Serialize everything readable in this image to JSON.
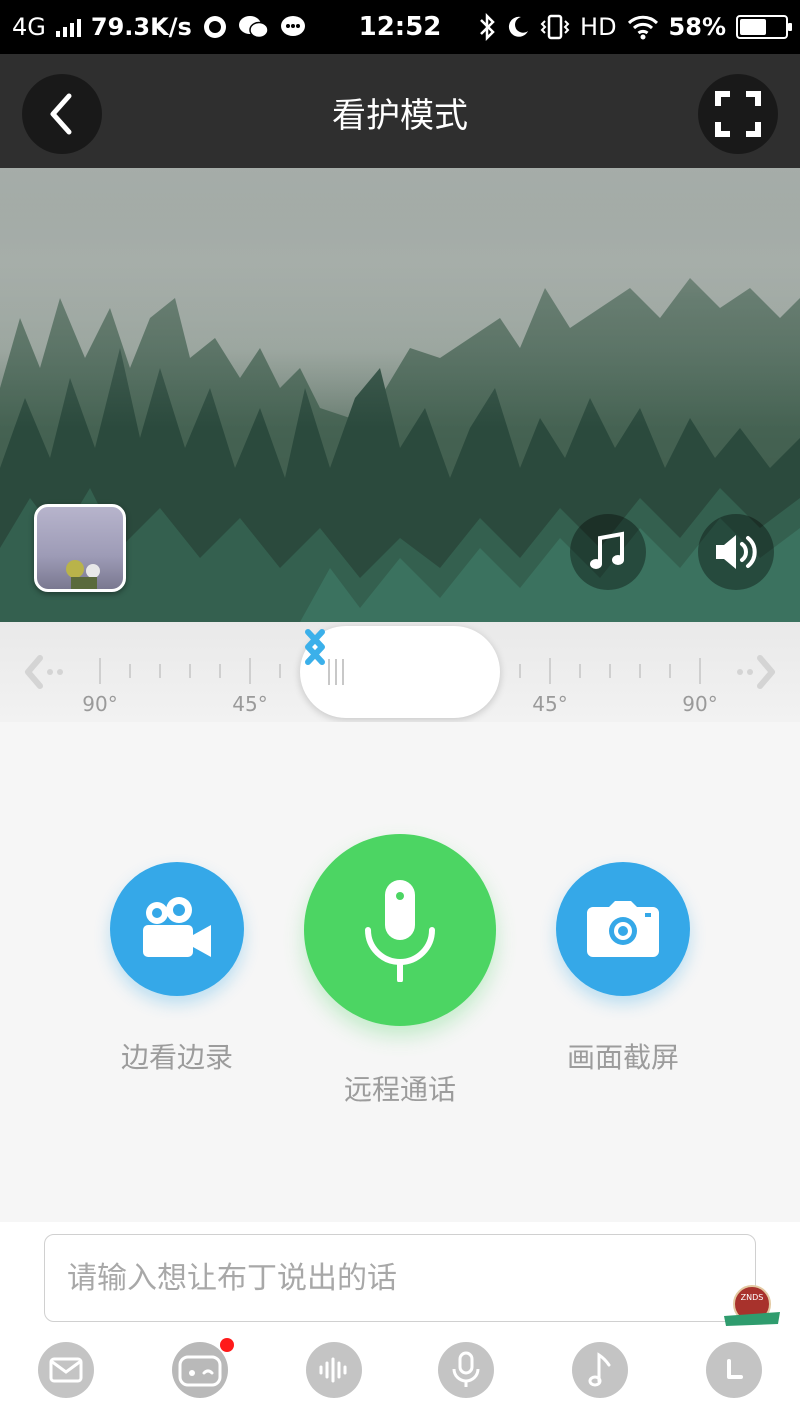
{
  "status_bar": {
    "network": "4G",
    "speed": "79.3K/s",
    "time": "12:52",
    "hd": "HD",
    "battery": "58%",
    "battery_level": 0.58
  },
  "header": {
    "title": "看护模式",
    "back_icon": "chevron-left-icon",
    "fullscreen_icon": "fullscreen-icon"
  },
  "video": {
    "music_icon": "music-note-icon",
    "volume_icon": "speaker-icon"
  },
  "ruler": {
    "labels": [
      "90°",
      "45°",
      "45°",
      "90°"
    ]
  },
  "actions": [
    {
      "label": "边看边录",
      "icon": "video-camera-icon",
      "color": "#35a8e8"
    },
    {
      "label": "远程通话",
      "icon": "microphone-icon",
      "color": "#4cd563"
    },
    {
      "label": "画面截屏",
      "icon": "camera-icon",
      "color": "#35a8e8"
    }
  ],
  "input": {
    "placeholder": "请输入想让布丁说出的话",
    "value": ""
  },
  "tabbar": {
    "icons": [
      "mail-icon",
      "robot-face-icon",
      "sound-wave-icon",
      "microphone-icon",
      "music-note-icon",
      "clock-icon"
    ],
    "badge_color": "#ff1a1a"
  },
  "watermark": {
    "text": "ZNDS"
  }
}
